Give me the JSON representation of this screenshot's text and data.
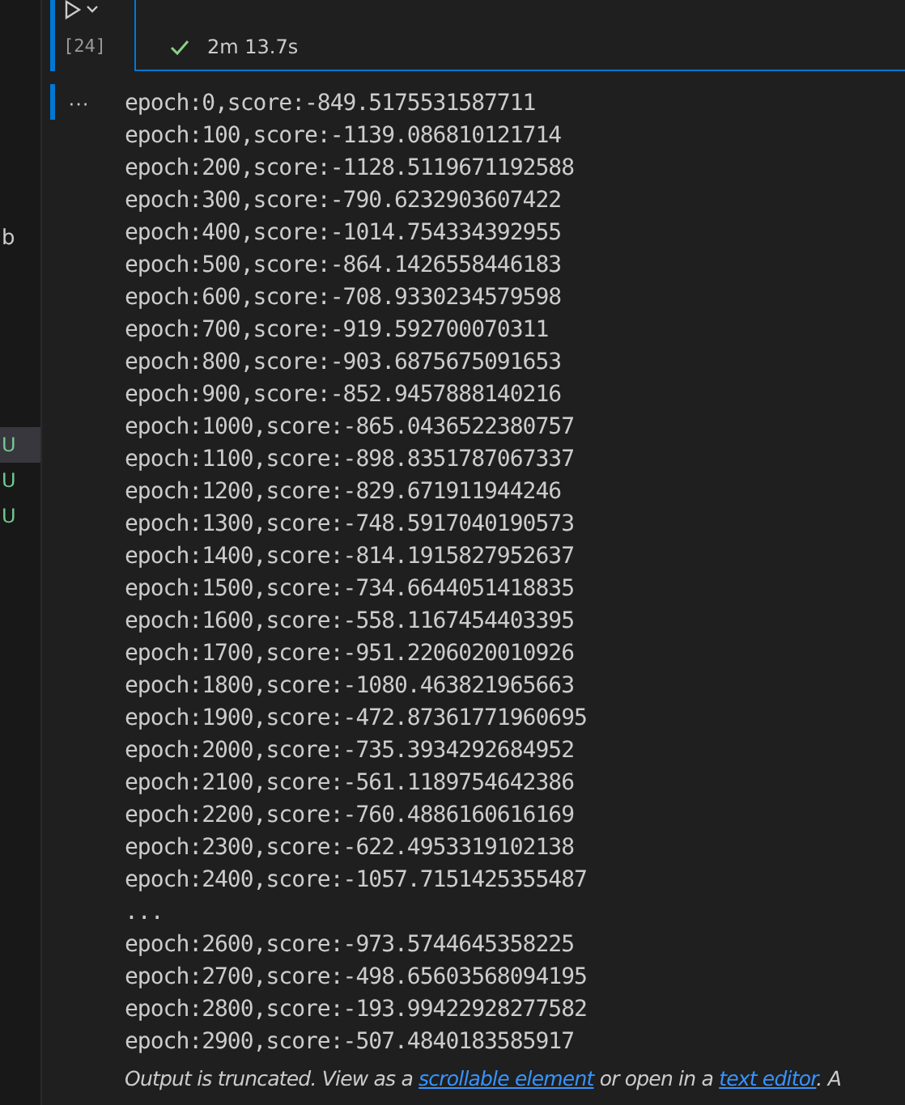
{
  "sidebar": {
    "label": "b",
    "items": [
      {
        "status": "U",
        "selected": true
      },
      {
        "status": "U",
        "selected": false
      },
      {
        "status": "U",
        "selected": false
      }
    ]
  },
  "cell": {
    "execution_count": "[24]",
    "passed": true,
    "duration": "2m 13.7s",
    "output_marker": "···",
    "output_lines": [
      "epoch:0,score:-849.5175531587711",
      "epoch:100,score:-1139.086810121714",
      "epoch:200,score:-1128.5119671192588",
      "epoch:300,score:-790.6232903607422",
      "epoch:400,score:-1014.754334392955",
      "epoch:500,score:-864.1426558446183",
      "epoch:600,score:-708.9330234579598",
      "epoch:700,score:-919.592700070311",
      "epoch:800,score:-903.6875675091653",
      "epoch:900,score:-852.9457888140216",
      "epoch:1000,score:-865.0436522380757",
      "epoch:1100,score:-898.8351787067337",
      "epoch:1200,score:-829.671911944246",
      "epoch:1300,score:-748.5917040190573",
      "epoch:1400,score:-814.1915827952637",
      "epoch:1500,score:-734.6644051418835",
      "epoch:1600,score:-558.1167454403395",
      "epoch:1700,score:-951.2206020010926",
      "epoch:1800,score:-1080.463821965663",
      "epoch:1900,score:-472.87361771960695",
      "epoch:2000,score:-735.3934292684952",
      "epoch:2100,score:-561.1189754642386",
      "epoch:2200,score:-760.4886160616169",
      "epoch:2300,score:-622.4953319102138",
      "epoch:2400,score:-1057.7151425355487",
      "...",
      "epoch:2600,score:-973.5744645358225",
      "epoch:2700,score:-498.65603568094195",
      "epoch:2800,score:-193.99422928277582",
      "epoch:2900,score:-507.4840183585917"
    ],
    "truncation": {
      "text_before": "Output is truncated. View as a ",
      "link_1": "scrollable element",
      "text_middle": " or open in a ",
      "link_2": "text editor",
      "text_after": ". A"
    }
  }
}
